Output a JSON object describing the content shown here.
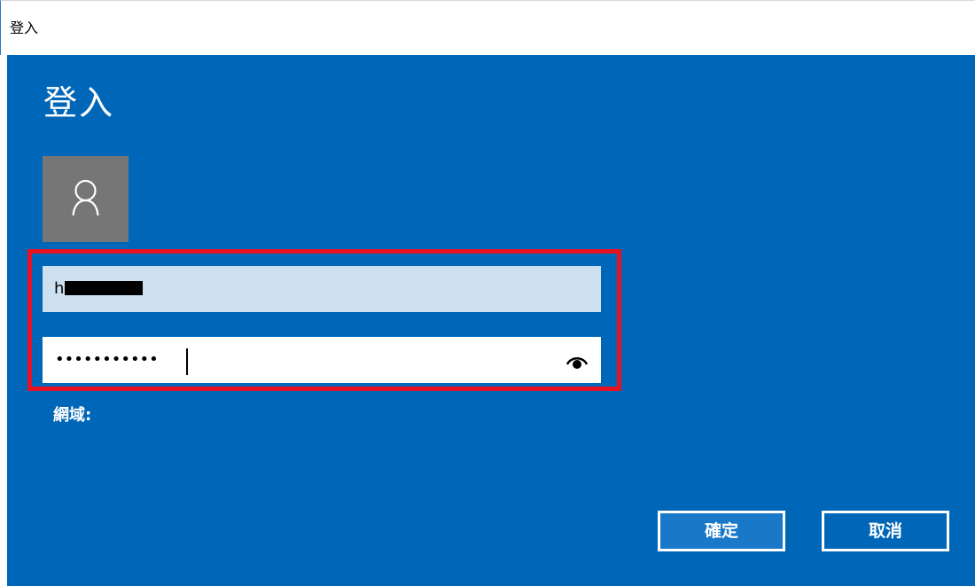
{
  "window": {
    "title": "登入"
  },
  "dialog": {
    "heading": "登入",
    "username": {
      "value": "h"
    },
    "password": {
      "masked_value": "•••••••••••"
    },
    "domain_label": "網域:",
    "buttons": {
      "ok_label": "確定",
      "cancel_label": "取消"
    }
  },
  "colors": {
    "background": "#0067b8",
    "avatar": "#767676",
    "username_field": "#cce0f0",
    "highlight": "#e81123",
    "ok_button": "#1a78c9"
  },
  "icons": {
    "avatar": "user-icon",
    "password_reveal": "eye-icon"
  }
}
